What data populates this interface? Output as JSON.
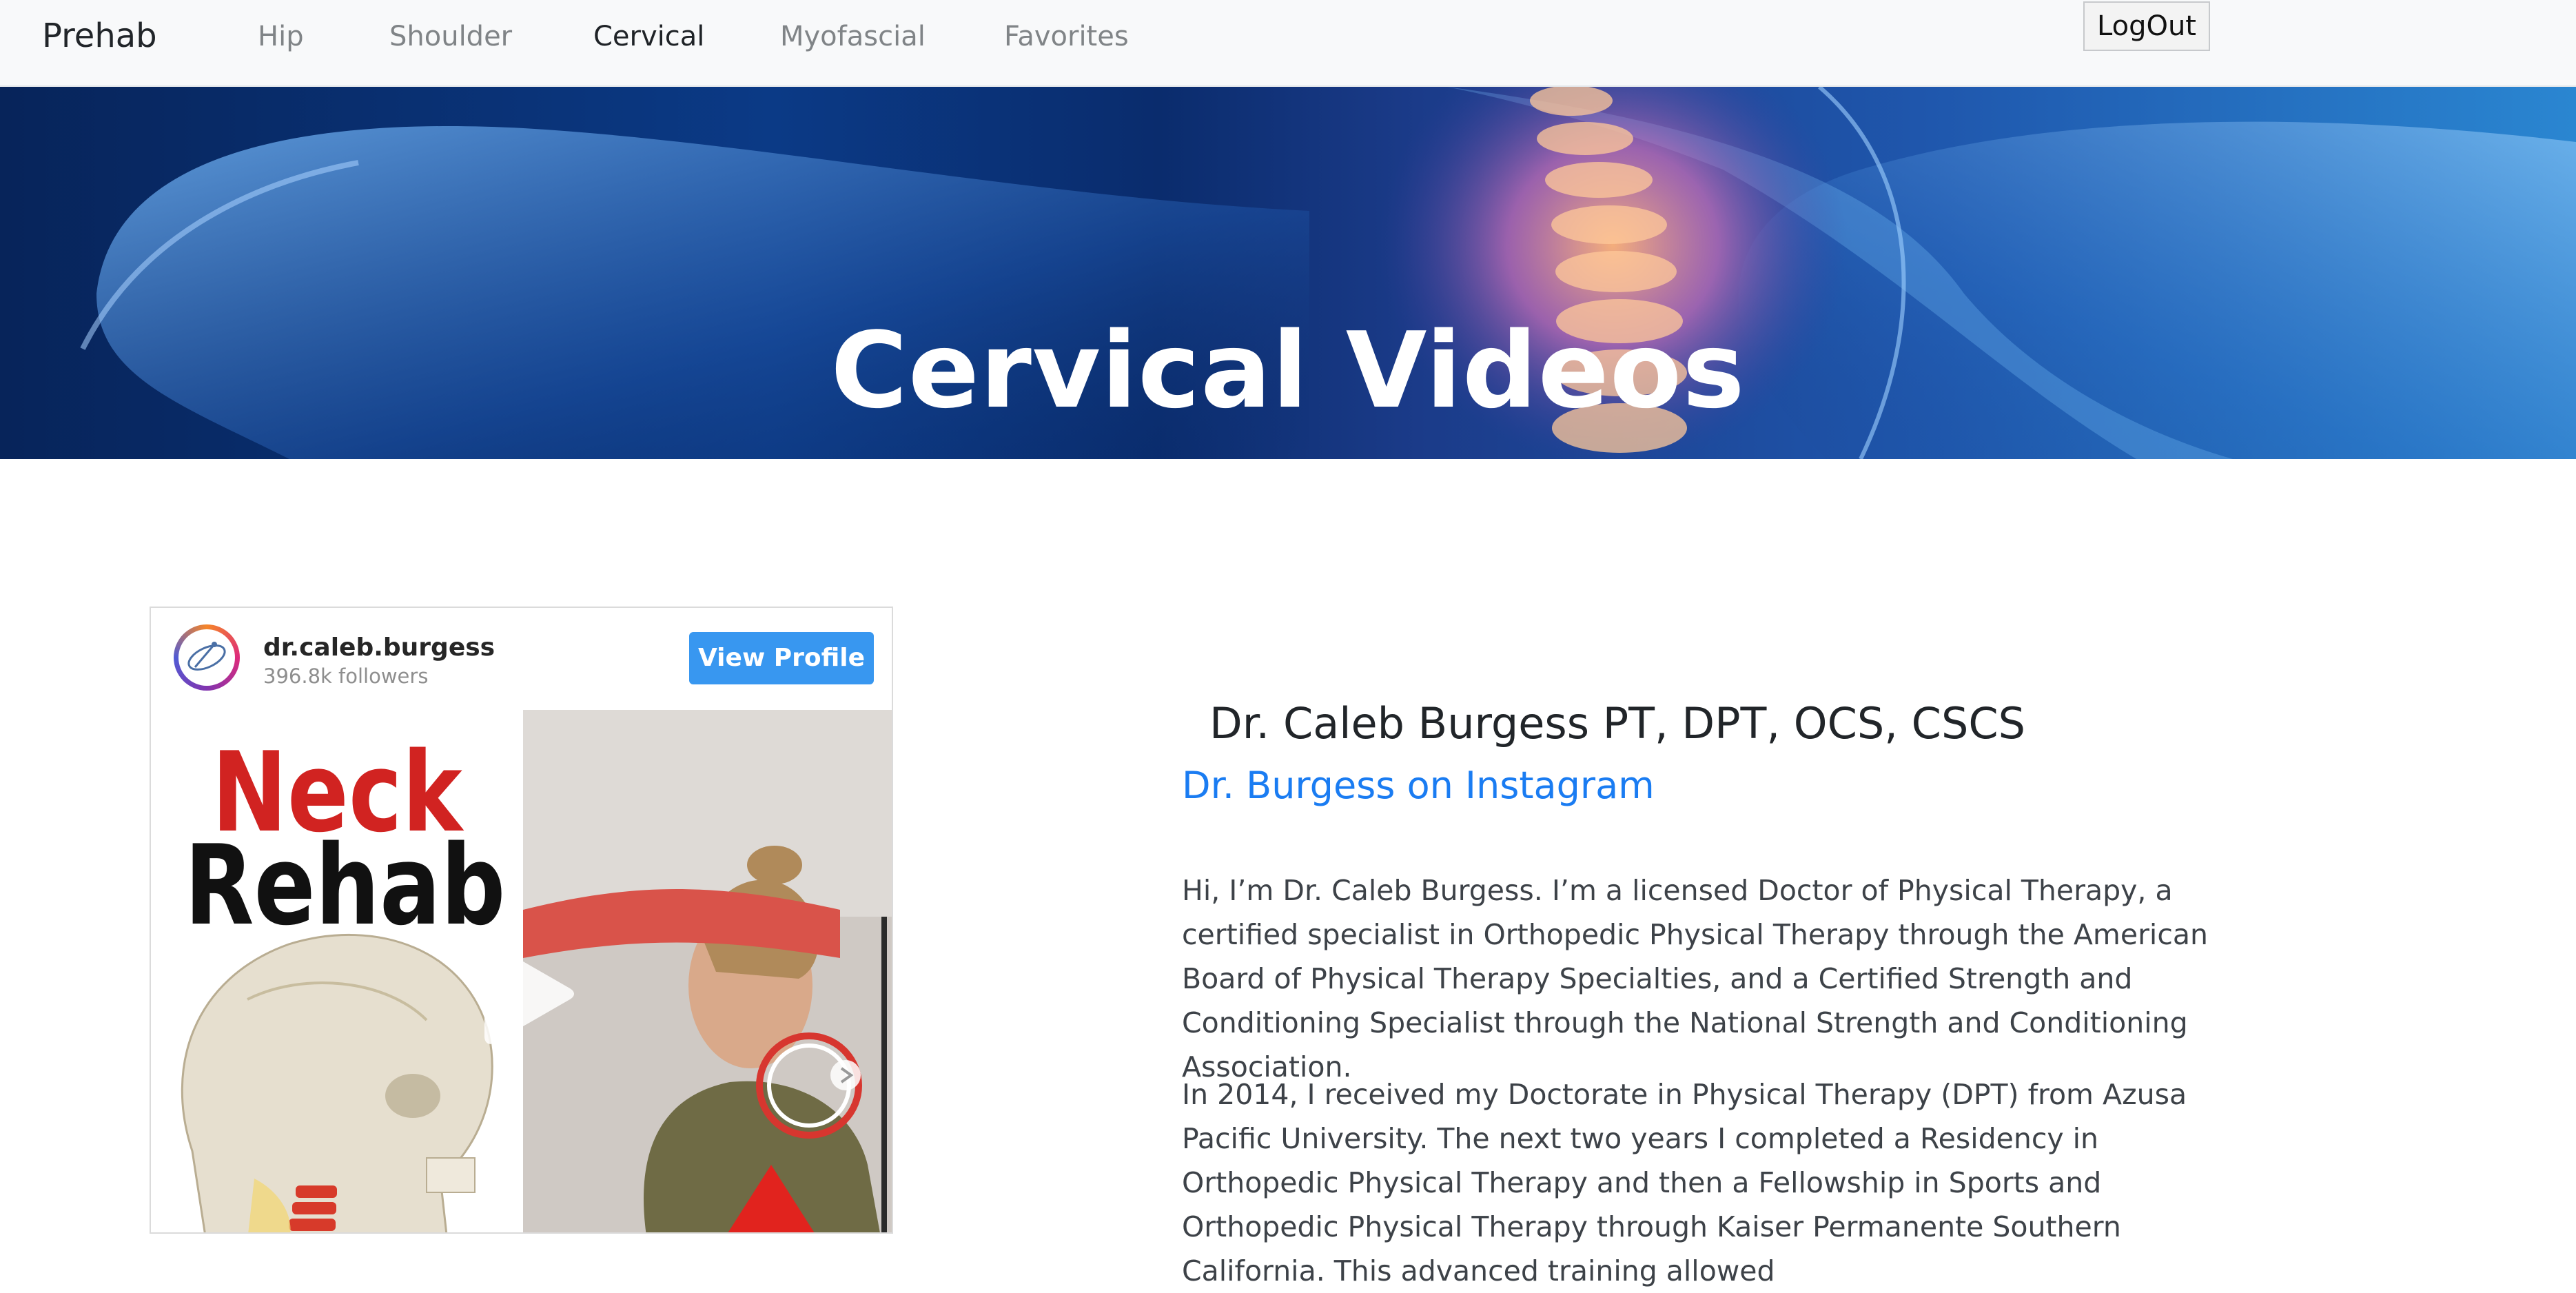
{
  "nav": {
    "brand": "Prehab",
    "links": [
      {
        "label": "Hip",
        "active": false
      },
      {
        "label": "Shoulder",
        "active": false
      },
      {
        "label": "Cervical",
        "active": true
      },
      {
        "label": "Myofascial",
        "active": false
      },
      {
        "label": "Favorites",
        "active": false
      }
    ],
    "logout_label": "LogOut"
  },
  "hero": {
    "title": "Cervical Videos"
  },
  "instagram_card": {
    "username": "dr.caleb.burgess",
    "followers": "396.8k followers",
    "view_profile_label": "View Profile",
    "thumbnail_text_line1": "Neck",
    "thumbnail_text_line2": "Rehab",
    "play_icon": "play-icon"
  },
  "bio": {
    "name": "Dr. Caleb Burgess PT, DPT, OCS, CSCS",
    "instagram_link": "Dr. Burgess on Instagram",
    "paragraph1": "Hi, I’m Dr. Caleb Burgess. I’m a licensed Doctor of Physical Therapy, a certified specialist in Orthopedic Physical Therapy through the American Board of Physical Therapy Specialties, and a Certified Strength and Conditioning Specialist through the National Strength and Conditioning Association.",
    "paragraph2": "In 2014, I received my Doctorate in Physical Therapy (DPT) from Azusa Pacific University. The next two years I completed a Residency in Orthopedic Physical Therapy and then a Fellowship in Sports and Orthopedic Physical Therapy through Kaiser Permanente Southern California. This advanced training allowed"
  },
  "colors": {
    "link_blue": "#1a7cf2",
    "instagram_blue": "#3897f0",
    "hero_dark": "#07245a"
  }
}
